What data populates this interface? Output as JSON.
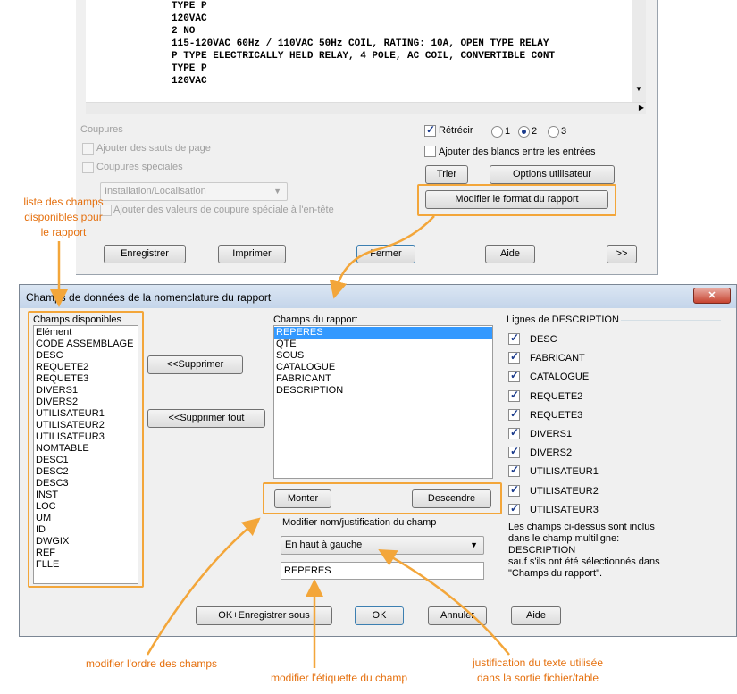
{
  "top_window": {
    "text_lines": [
      "TYPE P",
      "120VAC",
      "2 NO",
      "115-120VAC 60Hz / 110VAC 50Hz COIL, RATING: 10A, OPEN TYPE RELAY",
      "P TYPE ELECTRICALLY HELD RELAY, 4 POLE, AC COIL, CONVERTIBLE CONT",
      "TYPE P",
      "120VAC"
    ],
    "coupures_group": "Coupures",
    "sauts_page": "Ajouter des sauts de page",
    "coupures_speciales": "Coupures spéciales",
    "install_combo": "Installation/Localisation",
    "ajouter_valeurs": "Ajouter des valeurs de coupure spéciale à l'en-tête",
    "retrecir": "Rétrécir",
    "radio_1": "1",
    "radio_2": "2",
    "radio_3": "3",
    "ajouter_blancs": "Ajouter des blancs entre les entrées",
    "trier": "Trier",
    "options_utilisateur": "Options utilisateur",
    "modifier_format": "Modifier le format du rapport",
    "enregistrer": "Enregistrer",
    "imprimer": "Imprimer",
    "fermer": "Fermer",
    "aide": "Aide",
    "more": ">>"
  },
  "dialog": {
    "title": "Champs de données de la nomenclature du rapport",
    "close": "✕",
    "champs_disponibles_label": "Champs disponibles",
    "champs_disponibles": [
      "Elément",
      "CODE ASSEMBLAGE",
      "DESC",
      "REQUETE2",
      "REQUETE3",
      "DIVERS1",
      "DIVERS2",
      "UTILISATEUR1",
      "UTILISATEUR2",
      "UTILISATEUR3",
      "NOMTABLE",
      "DESC1",
      "DESC2",
      "DESC3",
      "INST",
      "LOC",
      "UM",
      "ID",
      "DWGIX",
      "REF",
      "FLLE"
    ],
    "supprimer": "<<Supprimer",
    "supprimer_tout": "<<Supprimer tout",
    "champs_rapport_label": "Champs du rapport",
    "champs_rapport": [
      "REPERES",
      "QTE",
      "SOUS",
      "CATALOGUE",
      "FABRICANT",
      "DESCRIPTION"
    ],
    "monter": "Monter",
    "descendre": "Descendre",
    "modifier_nom_label": "Modifier nom/justification du champ",
    "justification": "En haut à gauche",
    "nom_champ": "REPERES",
    "lignes_desc_label": "Lignes de DESCRIPTION",
    "lignes_desc": [
      "DESC",
      "FABRICANT",
      "CATALOGUE",
      "REQUETE2",
      "REQUETE3",
      "DIVERS1",
      "DIVERS2",
      "UTILISATEUR1",
      "UTILISATEUR2",
      "UTILISATEUR3"
    ],
    "note_lines": [
      "Les champs ci-dessus sont inclus",
      "dans le champ multiligne:",
      "DESCRIPTION",
      "sauf s'ils ont été sélectionnés dans",
      "\"Champs du rapport\"."
    ],
    "ok_enregistrer": "OK+Enregistrer sous",
    "ok": "OK",
    "annuler": "Annuler",
    "aide": "Aide"
  },
  "annotations": {
    "liste_champs": [
      "liste des champs",
      "disponibles pour",
      "le rapport"
    ],
    "ordre": "modifier l'ordre des champs",
    "etiquette": "modifier l'étiquette du champ",
    "justif": [
      "justification du texte utilisée",
      "dans la sortie fichier/table"
    ]
  },
  "colors": {
    "accent": "#f3a63a",
    "annotation_text": "#e5700e",
    "selection": "#3399ff"
  }
}
